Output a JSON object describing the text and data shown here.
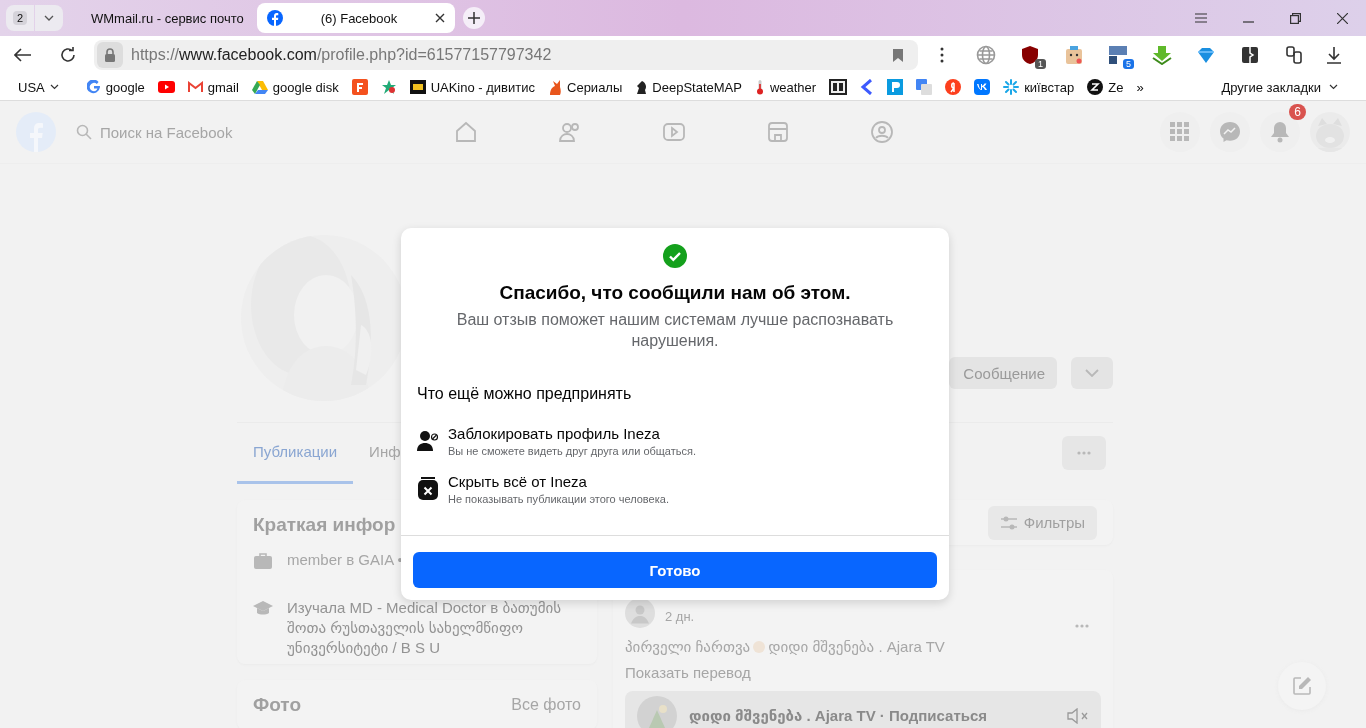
{
  "browser": {
    "tab_count": "2",
    "tabs": [
      {
        "title": "WMmail.ru - сервис почто",
        "selected": false
      },
      {
        "title": "(6) Facebook",
        "selected": true
      }
    ],
    "address": {
      "scheme": "https://",
      "host": "www.facebook.com",
      "path": "/profile.php?id=61577157797342"
    },
    "extensions": [
      {
        "kind": "globe"
      },
      {
        "kind": "shield",
        "badge": "1"
      },
      {
        "kind": "face"
      },
      {
        "kind": "puzzle",
        "badge": "5"
      },
      {
        "kind": "arrow"
      },
      {
        "kind": "diamond"
      },
      {
        "kind": "split"
      },
      {
        "kind": "keys"
      }
    ],
    "bookmarks": [
      {
        "kind": "folder",
        "label": "USA"
      },
      {
        "kind": "google",
        "label": "google"
      },
      {
        "kind": "youtube"
      },
      {
        "kind": "gmail",
        "label": "gmail"
      },
      {
        "kind": "drive",
        "label": "google disk"
      },
      {
        "kind": "square-orange"
      },
      {
        "kind": "star"
      },
      {
        "kind": "film",
        "label": "UAKino - дивитис"
      },
      {
        "kind": "cat",
        "label": "Сериалы"
      },
      {
        "kind": "chess",
        "label": "DeepStateMAP"
      },
      {
        "kind": "thermo",
        "label": "weather"
      },
      {
        "kind": "boxed"
      },
      {
        "kind": "chevron"
      },
      {
        "kind": "square-blue"
      },
      {
        "kind": "translate"
      },
      {
        "kind": "circle-red"
      },
      {
        "kind": "vk"
      },
      {
        "kind": "spark",
        "label": "київстар"
      },
      {
        "kind": "z",
        "label": "Ze"
      }
    ],
    "overflow": "»",
    "other_bookmarks": "Другие закладки"
  },
  "facebook": {
    "search_placeholder": "Поиск на Facebook",
    "notification_count": "6",
    "message_button": "Сообщение",
    "tabs": [
      {
        "label": "Публикации",
        "selected": true
      },
      {
        "label": "Инф",
        "selected": false
      }
    ],
    "intro": {
      "title": "Краткая инфор",
      "items": [
        {
          "kind": "work",
          "text": "member в GAIA •"
        },
        {
          "kind": "education",
          "text": "Изучала MD - Medical Doctor в ბათუმის შოთა რუსთაველის სახელმწიფო უნივერსიტეტი / B S U"
        }
      ]
    },
    "photos": {
      "title": "Фото",
      "link": "Все фото"
    },
    "filters_button": "Фильтры",
    "post": {
      "time": "2 дн.",
      "text": "პირველი ჩართვა",
      "text_after": "დიდი მშვენება . Ajara TV",
      "translate": "Показать перевод",
      "reel_title": "დიდი მშვენება . Ajara TV · Подписаться"
    }
  },
  "dialog": {
    "title": "Спасибо, что сообщили нам об этом.",
    "message": "Ваш отзыв поможет нашим системам лучше распознавать нарушения.",
    "section": "Что ещё можно предпринять",
    "actions": [
      {
        "kind": "block",
        "title": "Заблокировать профиль Ineza",
        "subtitle": "Вы не сможете видеть друг друга или общаться."
      },
      {
        "kind": "hide",
        "title": "Скрыть всё от Ineza",
        "subtitle": "Не показывать публикации этого человека."
      }
    ],
    "done_button": "Готово"
  }
}
